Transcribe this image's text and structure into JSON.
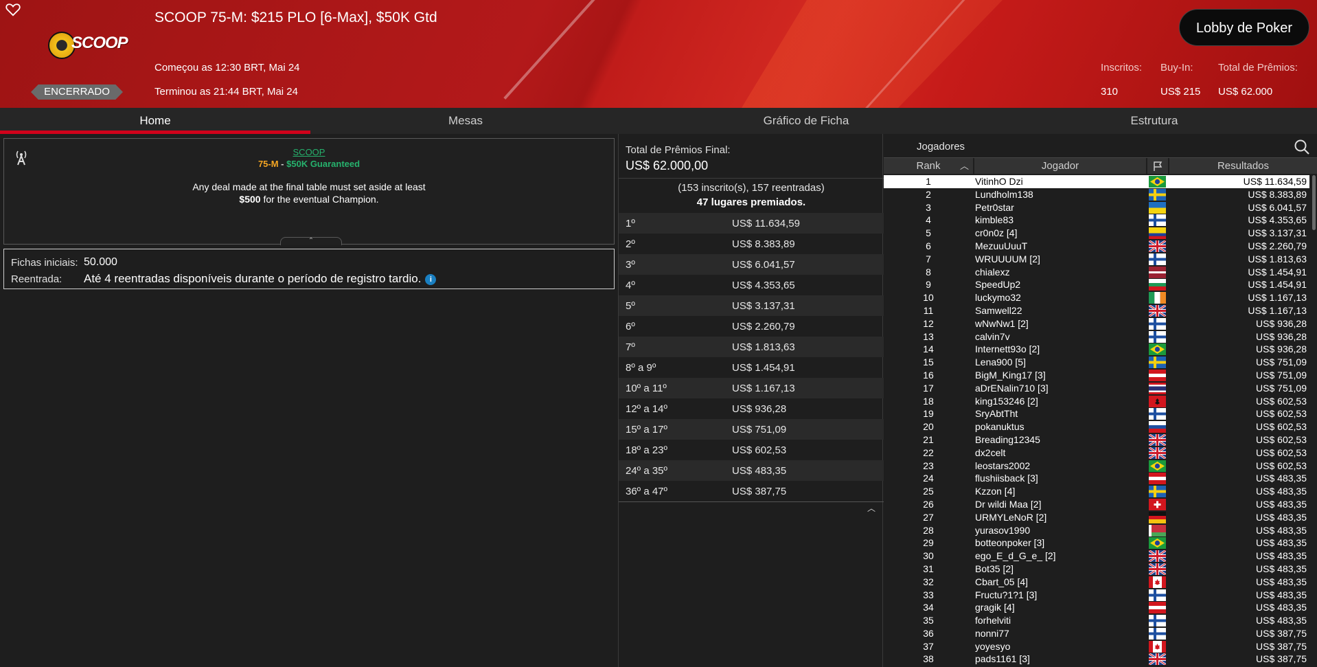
{
  "header": {
    "title": "SCOOP 75-M: $215 PLO [6-Max], $50K Gtd",
    "started": "Começou as 12:30 BRT, Mai 24",
    "ended": "Terminou as 21:44 BRT, Mai 24",
    "status": "ENCERRADO",
    "logo_text": "SCOOP",
    "lobby_button": "Lobby de Poker",
    "stats": {
      "entrants_label": "Inscritos:",
      "entrants_value": "310",
      "buyin_label": "Buy-In:",
      "buyin_value": "US$ 215",
      "prize_label": "Total de Prêmios:",
      "prize_value": "US$ 62.000"
    }
  },
  "tabs": [
    "Home",
    "Mesas",
    "Gráfico de Ficha",
    "Estrutura"
  ],
  "info": {
    "series_link": "SCOOP",
    "event_code": "75-M",
    "event_sep": " - ",
    "event_guarantee": "$50K Guaranteed",
    "deal_line1": "Any deal made at the final table must set aside at least",
    "deal_amount": "$500",
    "deal_line2": " for the eventual Champion.",
    "chips_label": "Fichas iniciais:",
    "chips_value": "50.000",
    "reentry_label": "Reentrada:",
    "reentry_value": "Até 4 reentradas disponíveis durante o período de registro tardio.",
    "info_glyph": "i"
  },
  "prizes": {
    "title": "Total de Prêmios Final:",
    "total": "US$ 62.000,00",
    "entries": "(153 inscrito(s), 157 reentradas)",
    "paid": "47 lugares premiados.",
    "rows": [
      {
        "place": "1º",
        "amount": "US$ 11.634,59"
      },
      {
        "place": "2º",
        "amount": "US$ 8.383,89"
      },
      {
        "place": "3º",
        "amount": "US$ 6.041,57"
      },
      {
        "place": "4º",
        "amount": "US$ 4.353,65"
      },
      {
        "place": "5º",
        "amount": "US$ 3.137,31"
      },
      {
        "place": "6º",
        "amount": "US$ 2.260,79"
      },
      {
        "place": "7º",
        "amount": "US$ 1.813,63"
      },
      {
        "place": "8º a 9º",
        "amount": "US$ 1.454,91"
      },
      {
        "place": "10º a 11º",
        "amount": "US$ 1.167,13"
      },
      {
        "place": "12º a 14º",
        "amount": "US$ 936,28"
      },
      {
        "place": "15º a 17º",
        "amount": "US$ 751,09"
      },
      {
        "place": "18º a 23º",
        "amount": "US$ 602,53"
      },
      {
        "place": "24º a 35º",
        "amount": "US$ 483,35"
      },
      {
        "place": "36º a 47º",
        "amount": "US$ 387,75"
      }
    ]
  },
  "players": {
    "title": "Jogadores",
    "columns": {
      "rank": "Rank",
      "player": "Jogador",
      "results": "Resultados"
    },
    "rows": [
      {
        "rank": "1",
        "name": "VitinhO Dzi",
        "flag": "br",
        "result": "US$ 11.634,59"
      },
      {
        "rank": "2",
        "name": "Lundholm138",
        "flag": "se",
        "result": "US$ 8.383,89"
      },
      {
        "rank": "3",
        "name": "Petr0star",
        "flag": "ua",
        "result": "US$ 6.041,57"
      },
      {
        "rank": "4",
        "name": "kimble83",
        "flag": "fi",
        "result": "US$ 4.353,65"
      },
      {
        "rank": "5",
        "name": "cr0n0z [4]",
        "flag": "co",
        "result": "US$ 3.137,31"
      },
      {
        "rank": "6",
        "name": "MezuuUuuT",
        "flag": "gb",
        "result": "US$ 2.260,79"
      },
      {
        "rank": "7",
        "name": "WRUUUUM [2]",
        "flag": "fi",
        "result": "US$ 1.813,63"
      },
      {
        "rank": "8",
        "name": "chialexz",
        "flag": "lv",
        "result": "US$ 1.454,91"
      },
      {
        "rank": "9",
        "name": "SpeedUp2",
        "flag": "bg",
        "result": "US$ 1.454,91"
      },
      {
        "rank": "10",
        "name": "luckymo32",
        "flag": "ie",
        "result": "US$ 1.167,13"
      },
      {
        "rank": "11",
        "name": "Samwell22",
        "flag": "gb",
        "result": "US$ 1.167,13"
      },
      {
        "rank": "12",
        "name": "wNwNw1 [2]",
        "flag": "fi",
        "result": "US$ 936,28"
      },
      {
        "rank": "13",
        "name": "calvin7v",
        "flag": "fi",
        "result": "US$ 936,28"
      },
      {
        "rank": "14",
        "name": "Internett93o [2]",
        "flag": "br",
        "result": "US$ 936,28"
      },
      {
        "rank": "15",
        "name": "Lena900 [5]",
        "flag": "se",
        "result": "US$ 751,09"
      },
      {
        "rank": "16",
        "name": "BigM_King17 [3]",
        "flag": "at",
        "result": "US$ 751,09"
      },
      {
        "rank": "17",
        "name": "aDrENalin710 [3]",
        "flag": "th",
        "result": "US$ 751,09"
      },
      {
        "rank": "18",
        "name": "king153246 [2]",
        "flag": "al",
        "result": "US$ 602,53"
      },
      {
        "rank": "19",
        "name": "SryAbtTht",
        "flag": "fi",
        "result": "US$ 602,53"
      },
      {
        "rank": "20",
        "name": "pokanuktus",
        "flag": "si",
        "result": "US$ 602,53"
      },
      {
        "rank": "21",
        "name": "Breading12345",
        "flag": "gb",
        "result": "US$ 602,53"
      },
      {
        "rank": "22",
        "name": "dx2celt",
        "flag": "gb",
        "result": "US$ 602,53"
      },
      {
        "rank": "23",
        "name": "leostars2002",
        "flag": "br",
        "result": "US$ 602,53"
      },
      {
        "rank": "24",
        "name": "flushiisback [3]",
        "flag": "at",
        "result": "US$ 483,35"
      },
      {
        "rank": "25",
        "name": "Kzzon [4]",
        "flag": "se",
        "result": "US$ 483,35"
      },
      {
        "rank": "26",
        "name": "Dr wildi Maa [2]",
        "flag": "ch",
        "result": "US$ 483,35"
      },
      {
        "rank": "27",
        "name": "URMYLeNoR [2]",
        "flag": "de",
        "result": "US$ 483,35"
      },
      {
        "rank": "28",
        "name": "yurasov1990",
        "flag": "by",
        "result": "US$ 483,35"
      },
      {
        "rank": "29",
        "name": "botteonpoker [3]",
        "flag": "br",
        "result": "US$ 483,35"
      },
      {
        "rank": "30",
        "name": "ego_E_d_G_e_ [2]",
        "flag": "gb",
        "result": "US$ 483,35"
      },
      {
        "rank": "31",
        "name": "Bot35 [2]",
        "flag": "gb",
        "result": "US$ 483,35"
      },
      {
        "rank": "32",
        "name": "Cbart_05 [4]",
        "flag": "ca",
        "result": "US$ 483,35"
      },
      {
        "rank": "33",
        "name": "Fructu?1?1 [3]",
        "flag": "fi",
        "result": "US$ 483,35"
      },
      {
        "rank": "34",
        "name": "gragik [4]",
        "flag": "at",
        "result": "US$ 483,35"
      },
      {
        "rank": "35",
        "name": "forhelviti",
        "flag": "fi",
        "result": "US$ 483,35"
      },
      {
        "rank": "36",
        "name": "nonni77",
        "flag": "fi",
        "result": "US$ 387,75"
      },
      {
        "rank": "37",
        "name": "yoyesyo",
        "flag": "ca",
        "result": "US$ 387,75"
      },
      {
        "rank": "38",
        "name": "pads1161 [3]",
        "flag": "gb",
        "result": "US$ 387,75"
      }
    ]
  }
}
